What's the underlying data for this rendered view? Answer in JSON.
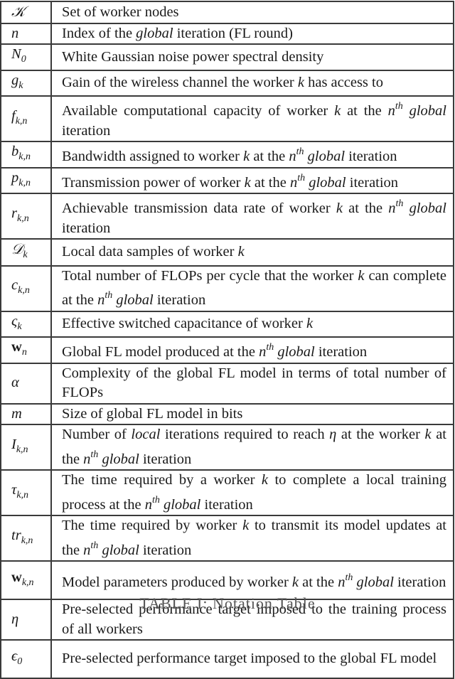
{
  "table": {
    "rows": [
      {
        "symbol": "𝒦",
        "symbol_kind": "cal",
        "description_html": "Set of worker nodes"
      },
      {
        "symbol": "n",
        "description_html": "Index of the <i>global</i> iteration (FL round)"
      },
      {
        "symbol": "N",
        "sub": "0",
        "description_html": "White Gaussian noise power spectral density"
      },
      {
        "symbol": "g",
        "sub": "k",
        "description_html": "Gain of the wireless channel the worker <i>k</i> has access to"
      },
      {
        "symbol": "f",
        "sub": "k,n",
        "description_html": "Available computational capacity of worker <i>k</i> at the <i>n</i><sup>th</sup> <i>global</i> iteration"
      },
      {
        "symbol": "b",
        "sub": "k,n",
        "description_html": "Bandwidth assigned to worker <i>k</i> at the <i>n</i><sup>th</sup> <i>global</i> iteration"
      },
      {
        "symbol": "p",
        "sub": "k,n",
        "description_html": "Transmission power of worker <i>k</i> at the <i>n</i><sup>th</sup> <i>global</i> iteration"
      },
      {
        "symbol": "r",
        "sub": "k,n",
        "description_html": "Achievable transmission data rate of worker <i>k</i> at the <i>n</i><sup>th</sup> <i>global</i> iteration"
      },
      {
        "symbol": "𝒟",
        "symbol_kind": "cal",
        "sub": "k",
        "description_html": "Local data samples of worker <i>k</i>"
      },
      {
        "symbol": "c",
        "sub": "k,n",
        "description_html": "Total number of FLOPs per cycle that the worker <i>k</i> can complete at the <i>n</i><sup>th</sup> <i>global</i> iteration"
      },
      {
        "symbol": "ς",
        "sub": "k",
        "description_html": "Effective switched capacitance of worker <i>k</i>"
      },
      {
        "symbol": "w",
        "symbol_kind": "bold",
        "sub": "n",
        "description_html": "Global FL model produced at the <i>n</i><sup>th</sup> <i>global</i> iteration"
      },
      {
        "symbol": "α",
        "description_html": "Complexity of the global FL model in terms of total number of FLOPs"
      },
      {
        "symbol": "m",
        "description_html": "Size of global FL model in bits"
      },
      {
        "symbol": "I",
        "sub": "k,n",
        "description_html": "Number of <i>local</i> iterations required to reach <i>η</i> at the worker <i>k</i> at the <i>n</i><sup>th</sup> <i>global</i> iteration"
      },
      {
        "symbol": "τ",
        "sub": "k,n",
        "description_html": "The time required by a worker <i>k</i> to complete a local training process at the <i>n</i><sup>th</sup> <i>global</i> iteration"
      },
      {
        "symbol": "tr",
        "sub": "k,n",
        "description_html": "The time required by worker <i>k</i> to transmit its model updates at the <i>n</i><sup>th</sup> <i>global</i> iteration"
      },
      {
        "symbol": "w",
        "symbol_kind": "bold",
        "sub": "k,n",
        "description_html": "Model parameters produced by worker <i>k</i> at the <i>n</i><sup>th</sup> <i>global</i> iteration"
      },
      {
        "symbol": "η",
        "description_html": "Pre-selected performance target imposed to the training process of all workers"
      },
      {
        "symbol": "ϵ",
        "sub": "0",
        "description_html": "Pre-selected performance target imposed to the global FL model"
      }
    ],
    "two_line_rows": [
      4,
      7,
      9,
      12,
      14,
      15,
      16,
      17,
      18,
      19
    ]
  },
  "caption": "TABLE I: Notation Table"
}
